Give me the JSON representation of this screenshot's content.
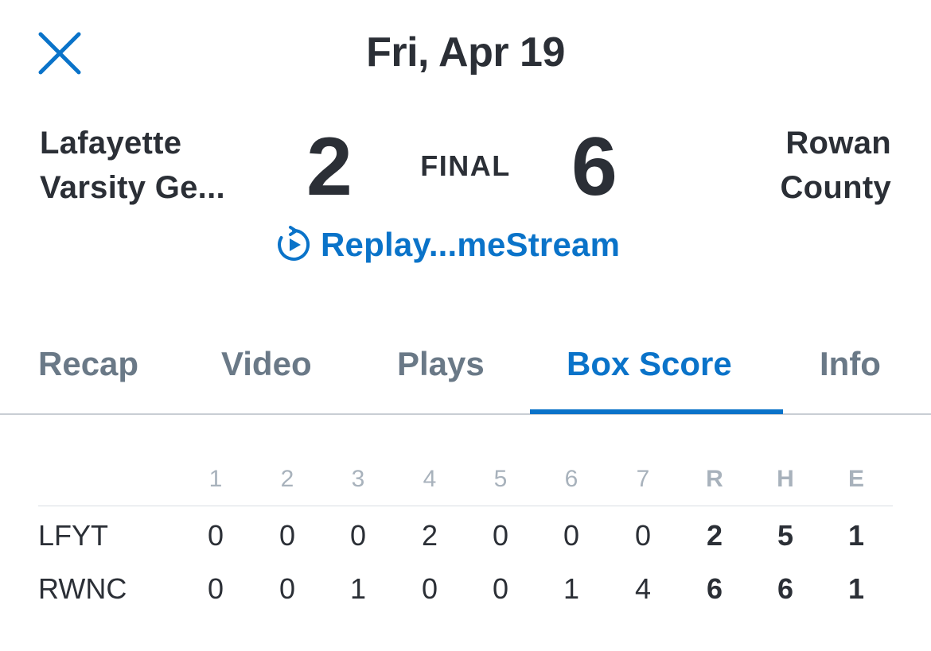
{
  "header": {
    "date": "Fri, Apr 19",
    "close_icon": "close-icon"
  },
  "game": {
    "status": "FINAL",
    "away": {
      "name_line1": "Lafayette",
      "name_line2": "Varsity Ge...",
      "score": "2"
    },
    "home": {
      "name_line1": "Rowan",
      "name_line2": "County",
      "score": "6"
    },
    "replay": {
      "label": "Replay...meStream",
      "icon": "replay-icon"
    }
  },
  "tabs": [
    {
      "label": "Recap",
      "active": false
    },
    {
      "label": "Video",
      "active": false
    },
    {
      "label": "Plays",
      "active": false
    },
    {
      "label": "Box Score",
      "active": true
    },
    {
      "label": "Info",
      "active": false
    }
  ],
  "box_score": {
    "columns": [
      "1",
      "2",
      "3",
      "4",
      "5",
      "6",
      "7",
      "R",
      "H",
      "E"
    ],
    "rows": [
      {
        "team": "LFYT",
        "values": [
          "0",
          "0",
          "0",
          "2",
          "0",
          "0",
          "0",
          "2",
          "5",
          "1"
        ]
      },
      {
        "team": "RWNC",
        "values": [
          "0",
          "0",
          "1",
          "0",
          "0",
          "1",
          "4",
          "6",
          "6",
          "1"
        ]
      }
    ]
  },
  "colors": {
    "accent": "#0a73c9",
    "text": "#2b2f36",
    "tab_inactive": "#6a7987",
    "header_muted": "#a8b2bc"
  }
}
